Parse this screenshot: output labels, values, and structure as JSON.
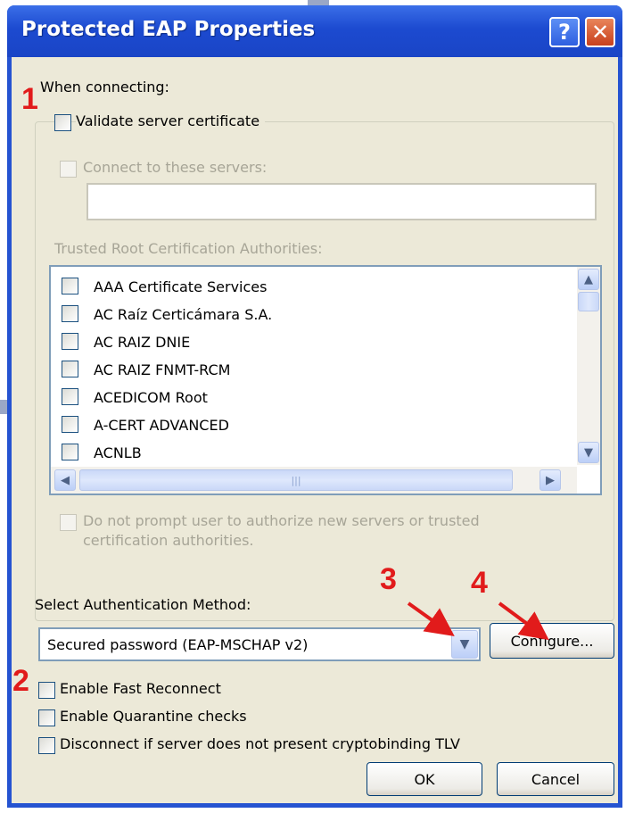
{
  "window": {
    "title": "Protected EAP Properties",
    "help_glyph": "?",
    "close_glyph": "✕"
  },
  "when_connecting": {
    "heading": "When connecting:",
    "validate_cert_label": "Validate server certificate",
    "connect_servers_label": "Connect to these servers:",
    "servers_value": "",
    "trusted_root_label": "Trusted Root Certification Authorities:"
  },
  "cert_list": {
    "items": [
      {
        "label": "AAA Certificate Services"
      },
      {
        "label": "AC Raíz Certicámara S.A."
      },
      {
        "label": "AC RAIZ DNIE"
      },
      {
        "label": "AC RAIZ FNMT-RCM"
      },
      {
        "label": "ACEDICOM Root"
      },
      {
        "label": "A-CERT ADVANCED"
      },
      {
        "label": "ACNLB"
      }
    ],
    "scroll_up": "▲",
    "scroll_down": "▼",
    "scroll_left": "◀",
    "scroll_right": "▶",
    "thumb_grip": "|||"
  },
  "do_not_prompt_line1": "Do not prompt user to authorize new servers or trusted",
  "do_not_prompt_line2": "certification authorities.",
  "auth": {
    "label": "Select Authentication Method:",
    "selected": "Secured password (EAP-MSCHAP v2)",
    "dropdown_glyph": "▼",
    "configure_label": "Configure..."
  },
  "options": {
    "fast_reconnect": "Enable Fast Reconnect",
    "quarantine": "Enable Quarantine checks",
    "cryptobinding": "Disconnect if server does not present cryptobinding TLV"
  },
  "buttons": {
    "ok": "OK",
    "cancel": "Cancel"
  },
  "annotations": {
    "a1": "1",
    "a2": "2",
    "a3": "3",
    "a4": "4",
    "color": "#e11b1b"
  }
}
